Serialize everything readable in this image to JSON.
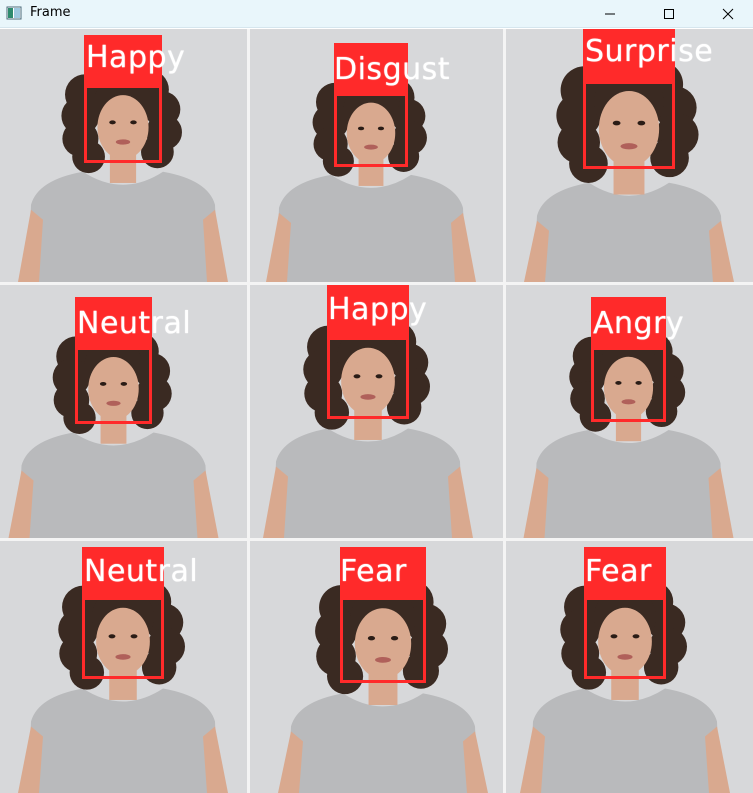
{
  "window": {
    "title": "Frame",
    "icons": {
      "app": "app-icon",
      "minimize": "minimize-icon",
      "maximize": "maximize-icon",
      "close": "close-icon"
    }
  },
  "detections": [
    {
      "emotion": "Happy"
    },
    {
      "emotion": "Disgust"
    },
    {
      "emotion": "Surprise"
    },
    {
      "emotion": "Neutral"
    },
    {
      "emotion": "Happy"
    },
    {
      "emotion": "Angry"
    },
    {
      "emotion": "Neutral"
    },
    {
      "emotion": "Fear"
    },
    {
      "emotion": "Fear"
    }
  ],
  "colors": {
    "box": "#ff2a2a",
    "label_text": "#ffffff",
    "titlebar": "#e9f6fb",
    "shirt": "#b9babc",
    "hair": "#3a2a22",
    "skin": "#d9a98f"
  }
}
